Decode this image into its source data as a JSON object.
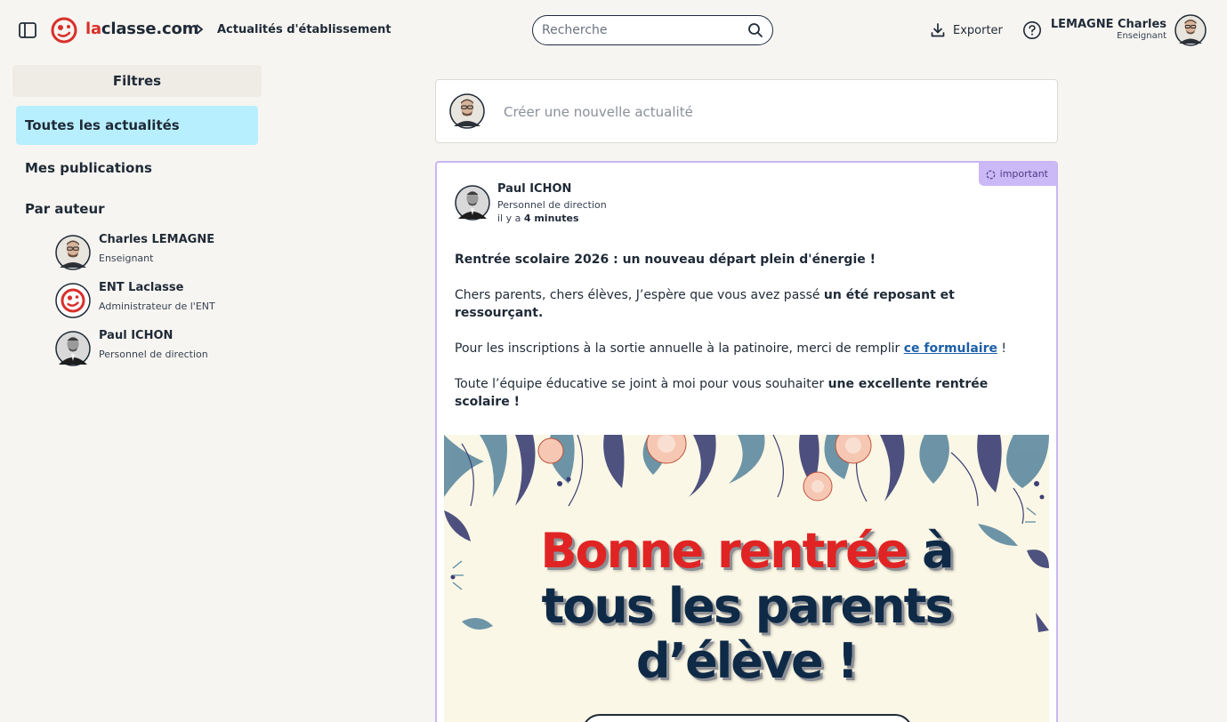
{
  "header": {
    "logo_prefix": "la",
    "logo_suffix": "classe.com",
    "breadcrumb": "Actualités d'établissement",
    "search_placeholder": "Recherche",
    "export_label": "Exporter",
    "user_name": "LEMAGNE Charles",
    "user_role": "Enseignant"
  },
  "sidebar": {
    "filters_title": "Filtres",
    "items": [
      {
        "label": "Toutes les actualités",
        "active": true
      },
      {
        "label": "Mes publications",
        "active": false
      }
    ],
    "authors_title": "Par auteur",
    "authors": [
      {
        "name": "Charles LEMAGNE",
        "role": "Enseignant"
      },
      {
        "name": "ENT Laclasse",
        "role": "Administrateur de l'ENT"
      },
      {
        "name": "Paul ICHON",
        "role": "Personnel de direction"
      }
    ]
  },
  "composer": {
    "placeholder": "Créer une nouvelle actualité"
  },
  "post": {
    "badge": "important",
    "author_name": "Paul ICHON",
    "author_role": "Personnel de direction",
    "time_prefix": "il y a",
    "time_value": "4 minutes",
    "title": "Rentrée scolaire 2026 : un nouveau départ plein d'énergie !",
    "p1_text": "Chers parents, chers élèves, J’espère que vous avez passé ",
    "p1_bold": "un été reposant et ressourçant.",
    "p2_text": "Pour les inscriptions à la sortie annuelle à la patinoire, merci de remplir ",
    "p2_link": "ce formulaire",
    "p2_end": " !",
    "p3_text": "Toute l’équipe éducative se joint à moi pour vous souhaiter ",
    "p3_bold": "une excellente rentrée scolaire !",
    "banner_red": "Bonne rentrée",
    "banner_line1_end": " à",
    "banner_line2": "tous les parents",
    "banner_line3": "d’élève !"
  },
  "colors": {
    "accent_red": "#d9302a",
    "active_filter": "#b8efff",
    "important_border": "#c9b6f2",
    "important_badge": "#cbb8f7"
  }
}
